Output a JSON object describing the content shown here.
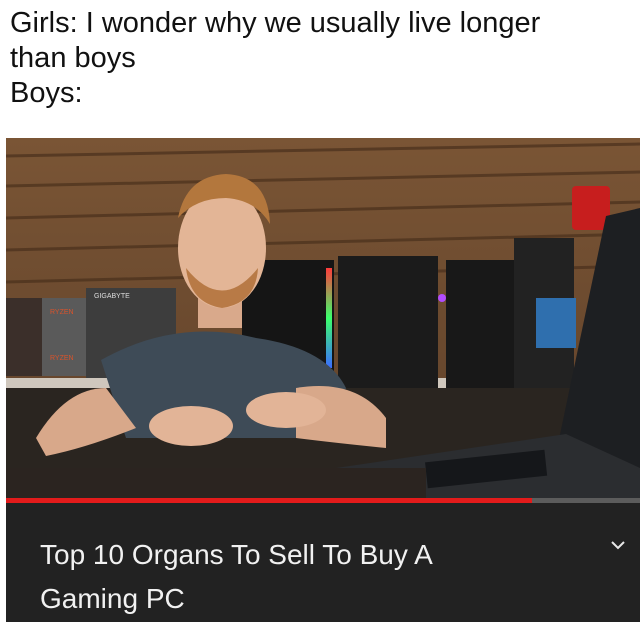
{
  "caption": {
    "line1": "Girls: I wonder why we usually live longer",
    "line2": "than boys",
    "line3": "Boys:"
  },
  "video": {
    "title_line1": "Top 10 Organs To Sell To Buy A",
    "title_line2": "Gaming PC",
    "progress_fraction": 0.83,
    "box_labels": [
      "GIGABYTE",
      "RYZEN",
      "RYZEN"
    ],
    "expand_icon": "chevron-down-icon"
  },
  "colors": {
    "progress": "#e21b1b",
    "panel": "#222222",
    "title_text": "#f1f1f1"
  }
}
